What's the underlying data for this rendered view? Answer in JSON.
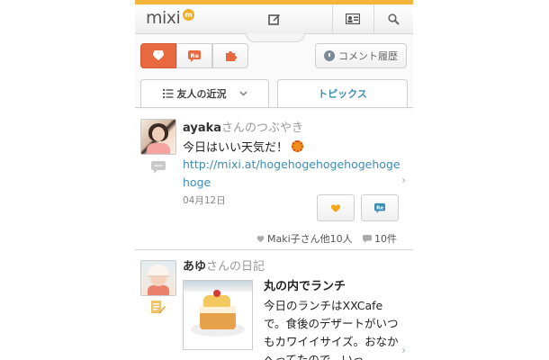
{
  "header": {
    "logo_text": "mixi",
    "logo_badge": "m",
    "icons": [
      "compose-icon",
      "profile-card-icon",
      "search-icon"
    ]
  },
  "filter_buttons": {
    "icons": [
      "heart-icon",
      "re-icon",
      "puzzle-icon"
    ],
    "active_index": 0
  },
  "history_button": {
    "label": "コメント履歴"
  },
  "tabs": {
    "friends": "友人の近況",
    "topics": "トピックス"
  },
  "feed": [
    {
      "user": "ayaka",
      "type_suffix": "さんのつぶやき",
      "message": "今日はいい天気だ！",
      "link": "http://mixi.at/hogehogehogehogehogehoge",
      "date": "04月12日",
      "likes": "Maki子さん他10人",
      "comments": "10件"
    },
    {
      "user": "あゆ",
      "type_suffix": "さんの日記",
      "title": "丸の内でランチ",
      "body": "今日のランチはXXCafeで。食後のデザートがいつもカワイイサイズ。おなかへってたので、いっ"
    }
  ],
  "colors": {
    "accent_orange": "#e8693f",
    "top_stripe": "#f3b63a",
    "link_blue": "#3b8eb6"
  }
}
